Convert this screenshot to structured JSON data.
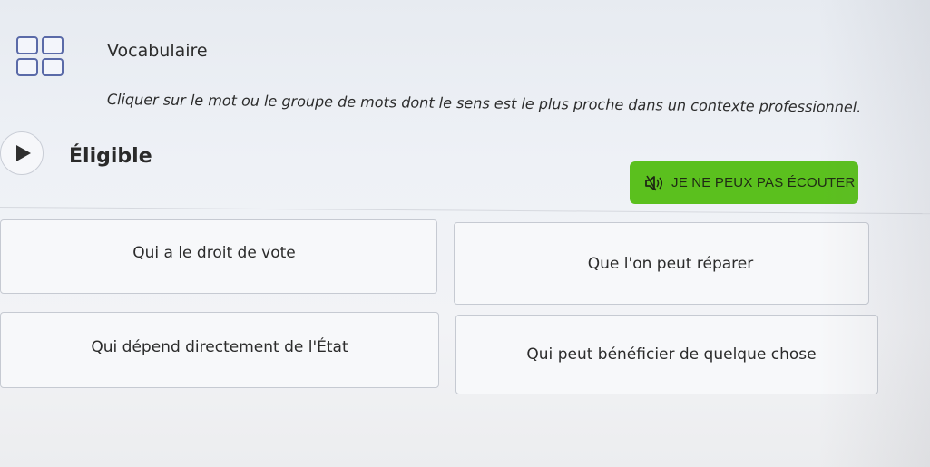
{
  "header": {
    "icon": "grid-icon",
    "title": "Vocabulaire",
    "instruction": "Cliquer sur le mot ou le groupe de mots dont le sens est le plus proche dans un contexte professionnel."
  },
  "question": {
    "play_icon": "play-icon",
    "word": "Éligible"
  },
  "listen_button": {
    "icon": "speaker-muted-icon",
    "label": "JE NE PEUX PAS ÉCOUTER",
    "color": "#5bc01e"
  },
  "options": [
    {
      "label": "Qui a le droit de vote"
    },
    {
      "label": "Que l'on peut réparer"
    },
    {
      "label": "Qui dépend directement de l'État"
    },
    {
      "label": "Qui peut bénéficier de quelque chose"
    }
  ]
}
